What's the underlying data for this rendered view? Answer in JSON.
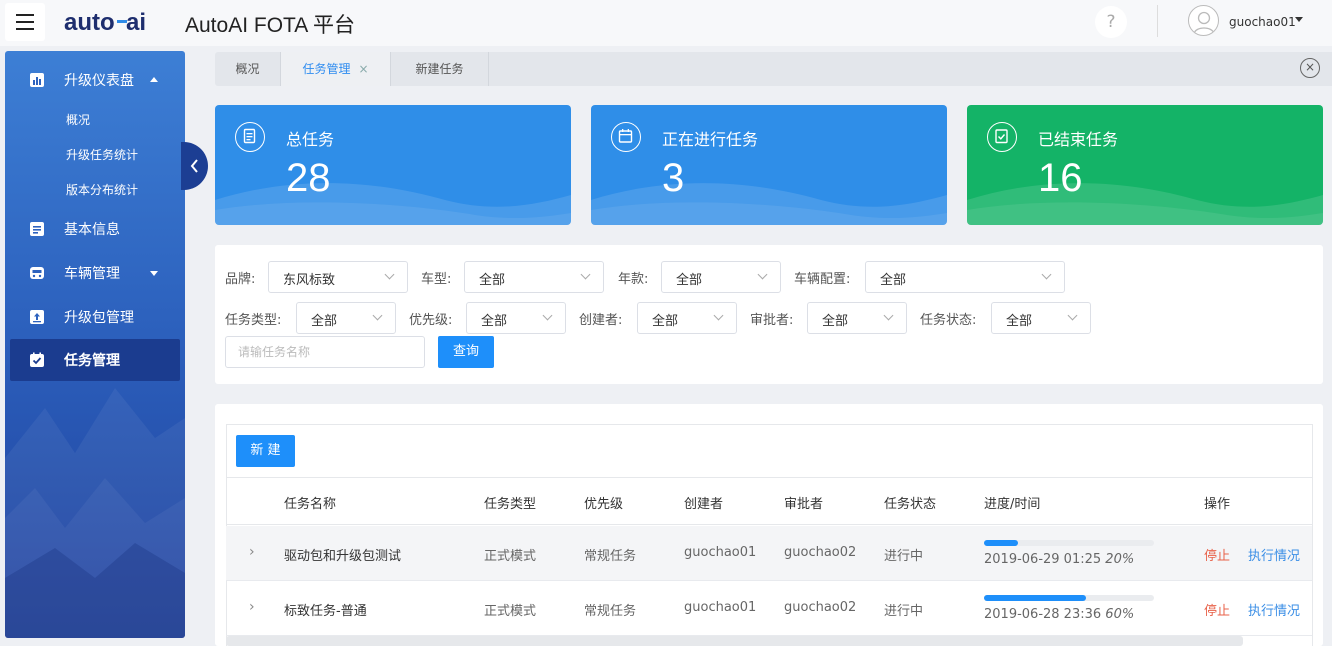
{
  "header": {
    "logo_text": "autoai",
    "title": "AutoAI FOTA 平台",
    "help": "?",
    "username": "guochao01"
  },
  "sidebar": {
    "items": [
      {
        "label": "升级仪表盘",
        "icon": "chart-icon",
        "expanded": true,
        "children": [
          "概况",
          "升级任务统计",
          "版本分布统计"
        ]
      },
      {
        "label": "基本信息",
        "icon": "info-list-icon"
      },
      {
        "label": "车辆管理",
        "icon": "vehicle-icon",
        "has_children": true
      },
      {
        "label": "升级包管理",
        "icon": "upload-icon"
      },
      {
        "label": "任务管理",
        "icon": "task-check-icon",
        "active": true
      }
    ]
  },
  "tabs": [
    {
      "label": "概况"
    },
    {
      "label": "任务管理",
      "active": true,
      "closable": true,
      "close": "×"
    },
    {
      "label": "新建任务"
    }
  ],
  "tabs_close": "×",
  "stats": [
    {
      "title": "总任务",
      "value": "28",
      "color": "#2f8ee8"
    },
    {
      "title": "正在进行任务",
      "value": "3",
      "color": "#2f8ee8"
    },
    {
      "title": "已结束任务",
      "value": "16",
      "color": "#14b367"
    }
  ],
  "filters": {
    "brand": {
      "label": "品牌:",
      "value": "东风标致"
    },
    "model": {
      "label": "车型:",
      "value": "全部"
    },
    "year": {
      "label": "年款:",
      "value": "全部"
    },
    "config": {
      "label": "车辆配置:",
      "value": "全部"
    },
    "task_type": {
      "label": "任务类型:",
      "value": "全部"
    },
    "priority": {
      "label": "优先级:",
      "value": "全部"
    },
    "creator": {
      "label": "创建者:",
      "value": "全部"
    },
    "approver": {
      "label": "审批者:",
      "value": "全部"
    },
    "status": {
      "label": "任务状态:",
      "value": "全部"
    },
    "search_placeholder": "请输任务名称",
    "query_button": "查询"
  },
  "table": {
    "new_button": "新 建",
    "columns": [
      "任务名称",
      "任务类型",
      "优先级",
      "创建者",
      "审批者",
      "任务状态",
      "进度/时间",
      "操作"
    ],
    "rows": [
      {
        "expand": "›",
        "name": "驱动包和升级包测试",
        "type": "正式模式",
        "priority": "常规任务",
        "creator": "guochao01",
        "approver": "guochao02",
        "status": "进行中",
        "progress": 0.2,
        "time": "2019-06-29 01:25",
        "percent": "20%",
        "stop": "停止",
        "exec": "执行情况"
      },
      {
        "expand": "›",
        "name": "标致任务-普通",
        "type": "正式模式",
        "priority": "常规任务",
        "creator": "guochao01",
        "approver": "guochao02",
        "status": "进行中",
        "progress": 0.6,
        "time": "2019-06-28 23:36",
        "percent": "60%",
        "stop": "停止",
        "exec": "执行情况"
      }
    ]
  },
  "colors": {
    "accent": "#1e8ffa",
    "sidebar": "#2d62be",
    "green": "#14b367",
    "danger": "#e8624a"
  }
}
